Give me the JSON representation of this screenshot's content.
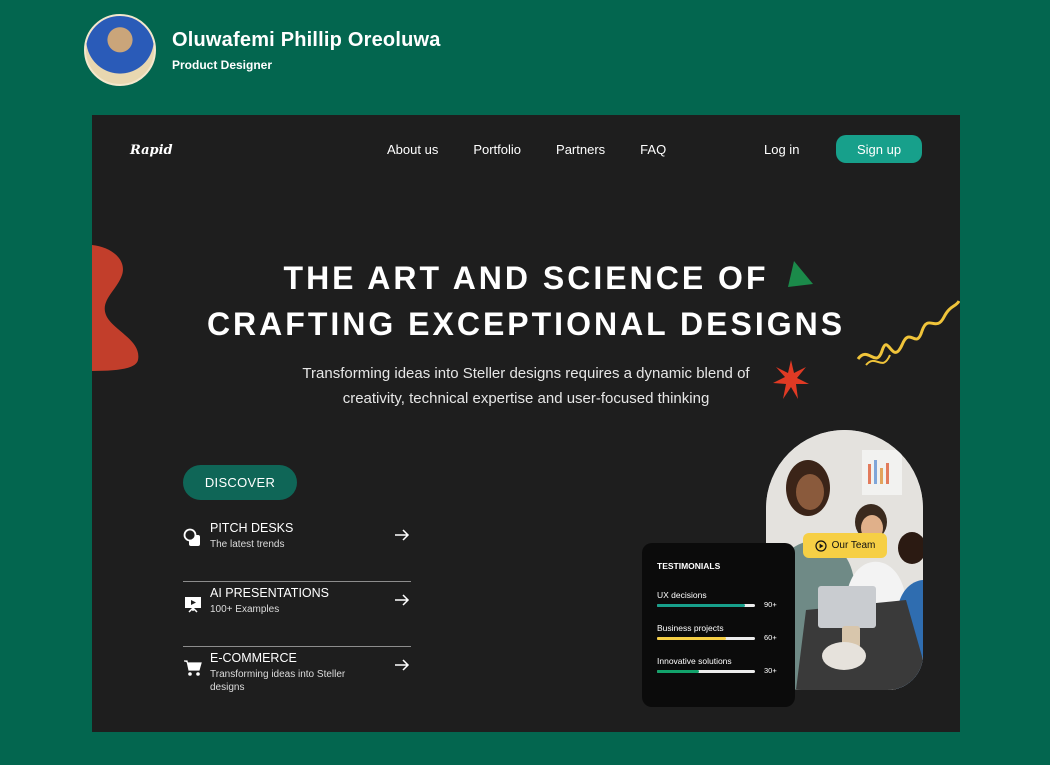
{
  "profile": {
    "name": "Oluwafemi Phillip Oreoluwa",
    "role": "Product Designer"
  },
  "site": {
    "logo": "Rapid",
    "nav": [
      "About us",
      "Portfolio",
      "Partners",
      "FAQ"
    ],
    "login": "Log in",
    "signup": "Sign up"
  },
  "hero": {
    "title_line1": "THE ART AND SCIENCE OF",
    "title_line2": "CRAFTING EXCEPTIONAL DESIGNS",
    "sub_line1": "Transforming ideas into Steller designs requires a dynamic blend of",
    "sub_line2": "creativity, technical expertise and user-focused thinking"
  },
  "discover": "DISCOVER",
  "menu": [
    {
      "title": "PITCH DESKS",
      "desc": "The latest trends",
      "icon": "shapes-icon"
    },
    {
      "title": "AI PRESENTATIONS",
      "desc": "100+ Examples",
      "icon": "presentation-icon"
    },
    {
      "title": "E-COMMERCE",
      "desc": "Transforming ideas into Steller designs",
      "icon": "cart-icon"
    }
  ],
  "badge": "Our Team",
  "testimonials": {
    "title": "TESTIMONIALS",
    "items": [
      {
        "label": "UX decisions",
        "value": "90+",
        "progress": 0.9,
        "color": "#17a08b"
      },
      {
        "label": "Business projects",
        "value": "60+",
        "progress": 0.7,
        "color": "#f6cf45"
      },
      {
        "label": "Innovative solutions",
        "value": "30+",
        "progress": 0.43,
        "color": "#12a36b"
      }
    ]
  },
  "colors": {
    "background": "#03664f",
    "screen": "#1e1e1e",
    "accent": "#17a08b",
    "badge": "#f6cf45",
    "blob": "#c23e2b"
  }
}
